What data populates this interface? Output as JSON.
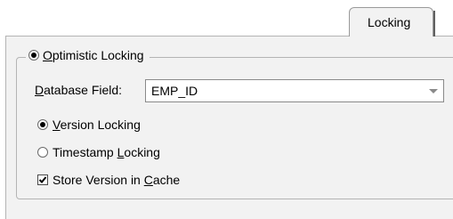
{
  "tab": {
    "label": "Locking"
  },
  "group": {
    "label_mnemonic": "O",
    "label_rest": "ptimistic Locking",
    "selected": true
  },
  "database_field": {
    "label_mnemonic": "D",
    "label_rest": "atabase Field:",
    "value": "EMP_ID"
  },
  "options": {
    "version": {
      "mnemonic": "V",
      "rest": "ersion Locking",
      "selected": true
    },
    "timestamp": {
      "pre": "Timestamp ",
      "mnemonic": "L",
      "rest": "ocking",
      "selected": false
    }
  },
  "store_version": {
    "pre": "Store Version in ",
    "mnemonic": "C",
    "rest": "ache",
    "checked": true
  }
}
